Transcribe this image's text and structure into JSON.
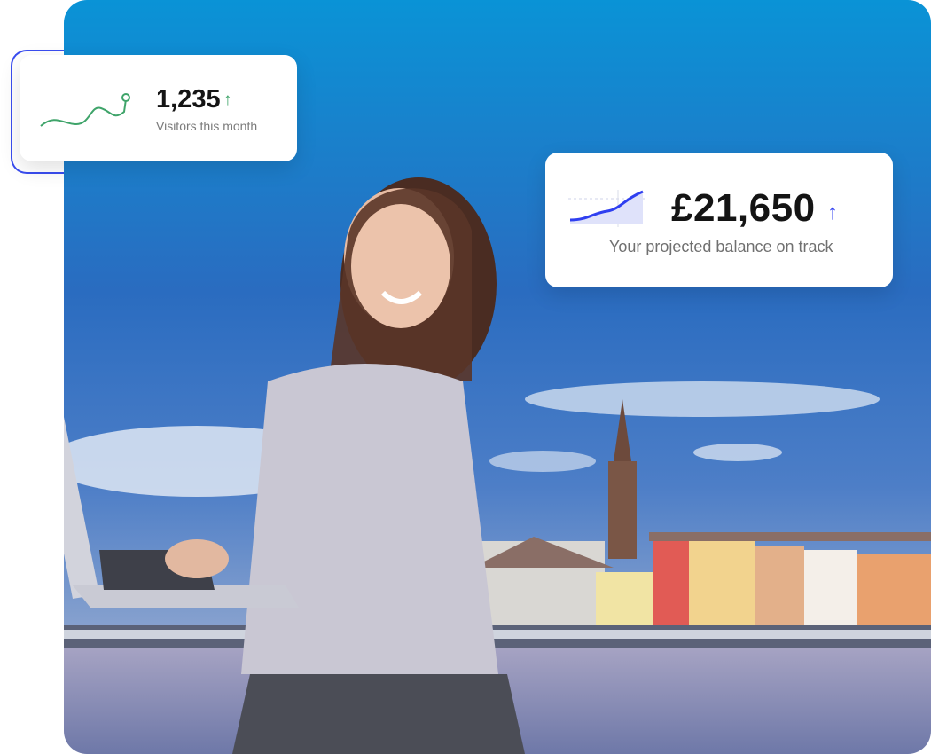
{
  "visitors_card": {
    "value": "1,235",
    "trend_icon": "arrow-up-icon",
    "caption": "Visitors this month",
    "accent": "#3fa46a"
  },
  "balance_card": {
    "value": "£21,650",
    "trend_icon": "arrow-up-icon",
    "caption": "Your projected balance on track",
    "accent": "#2f3ff0"
  },
  "scene": {
    "sky_top": "#0e8fd0",
    "sky_mid": "#2f6fc0",
    "water": "#8e8fb6"
  }
}
